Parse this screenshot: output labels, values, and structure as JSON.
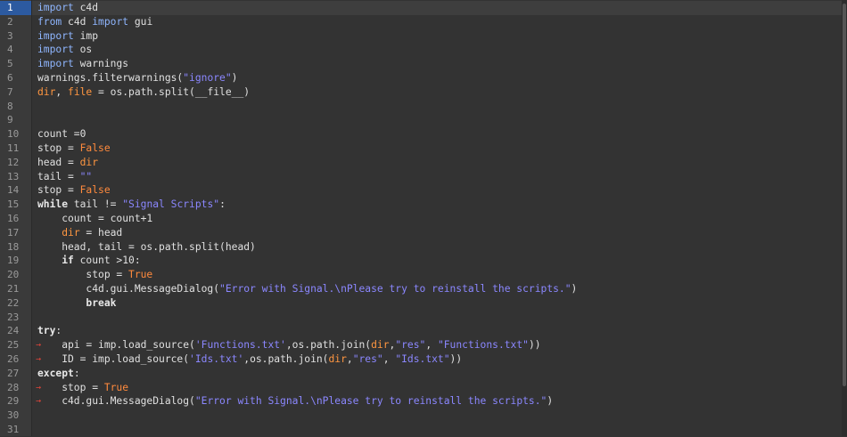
{
  "editor": {
    "lines": [
      {
        "num": "1",
        "tokens": [
          {
            "t": "import",
            "c": "kw2"
          },
          {
            "t": " c4d",
            "c": "plain"
          }
        ]
      },
      {
        "num": "2",
        "tokens": [
          {
            "t": "from",
            "c": "kw2"
          },
          {
            "t": " c4d ",
            "c": "plain"
          },
          {
            "t": "import",
            "c": "kw2"
          },
          {
            "t": " gui",
            "c": "plain"
          }
        ]
      },
      {
        "num": "3",
        "tokens": [
          {
            "t": "import",
            "c": "kw2"
          },
          {
            "t": " imp",
            "c": "plain"
          }
        ]
      },
      {
        "num": "4",
        "tokens": [
          {
            "t": "import",
            "c": "kw2"
          },
          {
            "t": " os",
            "c": "plain"
          }
        ]
      },
      {
        "num": "5",
        "tokens": [
          {
            "t": "import",
            "c": "kw2"
          },
          {
            "t": " warnings",
            "c": "plain"
          }
        ]
      },
      {
        "num": "6",
        "tokens": [
          {
            "t": "warnings.filterwarnings(",
            "c": "plain"
          },
          {
            "t": "\"ignore\"",
            "c": "str"
          },
          {
            "t": ")",
            "c": "plain"
          }
        ]
      },
      {
        "num": "7",
        "tokens": [
          {
            "t": "dir",
            "c": "var"
          },
          {
            "t": ", ",
            "c": "plain"
          },
          {
            "t": "file",
            "c": "var"
          },
          {
            "t": " = os.path.split(__file__)",
            "c": "plain"
          }
        ]
      },
      {
        "num": "8",
        "tokens": []
      },
      {
        "num": "9",
        "tokens": []
      },
      {
        "num": "10",
        "tokens": [
          {
            "t": "count =0",
            "c": "plain"
          }
        ]
      },
      {
        "num": "11",
        "tokens": [
          {
            "t": "stop = ",
            "c": "plain"
          },
          {
            "t": "False",
            "c": "bool"
          }
        ]
      },
      {
        "num": "12",
        "tokens": [
          {
            "t": "head = ",
            "c": "plain"
          },
          {
            "t": "dir",
            "c": "var"
          }
        ]
      },
      {
        "num": "13",
        "tokens": [
          {
            "t": "tail = ",
            "c": "plain"
          },
          {
            "t": "\"\"",
            "c": "str"
          }
        ]
      },
      {
        "num": "14",
        "tokens": [
          {
            "t": "stop = ",
            "c": "plain"
          },
          {
            "t": "False",
            "c": "bool"
          }
        ]
      },
      {
        "num": "15",
        "tokens": [
          {
            "t": "while",
            "c": "kw"
          },
          {
            "t": " tail != ",
            "c": "plain"
          },
          {
            "t": "\"Signal Scripts\"",
            "c": "str"
          },
          {
            "t": ":",
            "c": "plain"
          }
        ]
      },
      {
        "num": "16",
        "tokens": [
          {
            "t": "    count = count+1",
            "c": "plain"
          }
        ]
      },
      {
        "num": "17",
        "tokens": [
          {
            "t": "    ",
            "c": "plain"
          },
          {
            "t": "dir",
            "c": "var"
          },
          {
            "t": " = head",
            "c": "plain"
          }
        ]
      },
      {
        "num": "18",
        "tokens": [
          {
            "t": "    head, tail = os.path.split(head)",
            "c": "plain"
          }
        ]
      },
      {
        "num": "19",
        "tokens": [
          {
            "t": "    ",
            "c": "plain"
          },
          {
            "t": "if",
            "c": "kw"
          },
          {
            "t": " count >10:",
            "c": "plain"
          }
        ]
      },
      {
        "num": "20",
        "tokens": [
          {
            "t": "        stop = ",
            "c": "plain"
          },
          {
            "t": "True",
            "c": "bool"
          }
        ]
      },
      {
        "num": "21",
        "tokens": [
          {
            "t": "        c4d.gui.MessageDialog(",
            "c": "plain"
          },
          {
            "t": "\"Error with Signal.\\nPlease try to reinstall the scripts.\"",
            "c": "str"
          },
          {
            "t": ")",
            "c": "plain"
          }
        ]
      },
      {
        "num": "22",
        "tokens": [
          {
            "t": "        ",
            "c": "plain"
          },
          {
            "t": "break",
            "c": "kw"
          }
        ]
      },
      {
        "num": "23",
        "tokens": []
      },
      {
        "num": "24",
        "tokens": [
          {
            "t": "try",
            "c": "kw"
          },
          {
            "t": ":",
            "c": "plain"
          }
        ]
      },
      {
        "num": "25",
        "arrow": true,
        "tokens": [
          {
            "t": "    api = imp.load_source(",
            "c": "plain"
          },
          {
            "t": "'Functions.txt'",
            "c": "str"
          },
          {
            "t": ",os.path.join(",
            "c": "plain"
          },
          {
            "t": "dir",
            "c": "var"
          },
          {
            "t": ",",
            "c": "plain"
          },
          {
            "t": "\"res\"",
            "c": "str"
          },
          {
            "t": ", ",
            "c": "plain"
          },
          {
            "t": "\"Functions.txt\"",
            "c": "str"
          },
          {
            "t": "))",
            "c": "plain"
          }
        ]
      },
      {
        "num": "26",
        "arrow": true,
        "tokens": [
          {
            "t": "    ID = imp.load_source(",
            "c": "plain"
          },
          {
            "t": "'Ids.txt'",
            "c": "str"
          },
          {
            "t": ",os.path.join(",
            "c": "plain"
          },
          {
            "t": "dir",
            "c": "var"
          },
          {
            "t": ",",
            "c": "plain"
          },
          {
            "t": "\"res\"",
            "c": "str"
          },
          {
            "t": ", ",
            "c": "plain"
          },
          {
            "t": "\"Ids.txt\"",
            "c": "str"
          },
          {
            "t": "))",
            "c": "plain"
          }
        ]
      },
      {
        "num": "27",
        "tokens": [
          {
            "t": "except",
            "c": "kw"
          },
          {
            "t": ":",
            "c": "plain"
          }
        ]
      },
      {
        "num": "28",
        "arrow": true,
        "tokens": [
          {
            "t": "    stop = ",
            "c": "plain"
          },
          {
            "t": "True",
            "c": "bool"
          }
        ]
      },
      {
        "num": "29",
        "arrow": true,
        "tokens": [
          {
            "t": "    c4d.gui.MessageDialog(",
            "c": "plain"
          },
          {
            "t": "\"Error with Signal.\\nPlease try to reinstall the scripts.\"",
            "c": "str"
          },
          {
            "t": ")",
            "c": "plain"
          }
        ]
      },
      {
        "num": "30",
        "tokens": []
      },
      {
        "num": "31",
        "tokens": []
      }
    ],
    "arrow_glyph": "→"
  }
}
